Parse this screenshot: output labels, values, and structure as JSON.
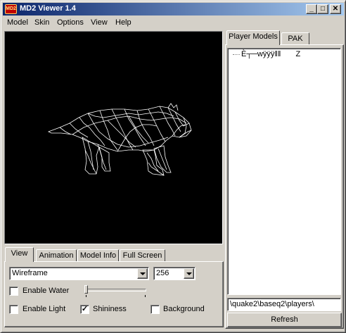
{
  "window": {
    "title": "MD2 Viewer 1.4",
    "icon_label": "MD2",
    "controls": {
      "minimize": "_",
      "maximize": "□",
      "close": "✕"
    }
  },
  "menu": [
    "Model",
    "Skin",
    "Options",
    "View",
    "Help"
  ],
  "viewport": {
    "background": "#000000",
    "render_mode": "wireframe",
    "model": "feline creature"
  },
  "bottom_tabs": [
    "View",
    "Animation",
    "Model Info",
    "Full Screen"
  ],
  "view_panel": {
    "render_mode_value": "Wireframe",
    "texture_size_value": "256",
    "enable_water": {
      "label": "Enable Water",
      "checked": false
    },
    "water_slider": {
      "value": 0.0
    },
    "enable_light": {
      "label": "Enable Light",
      "checked": false
    },
    "shininess": {
      "label": "Shininess",
      "checked": true
    },
    "background": {
      "label": "Background",
      "checked": false
    }
  },
  "right_tabs": [
    "Player Models",
    "PAK"
  ],
  "tree": {
    "items": [
      {
        "name": "È┬─wÿÿÿǁǁ",
        "suffix": "Z"
      }
    ]
  },
  "path": "\\quake2\\baseq2\\players\\",
  "refresh_label": "Refresh"
}
